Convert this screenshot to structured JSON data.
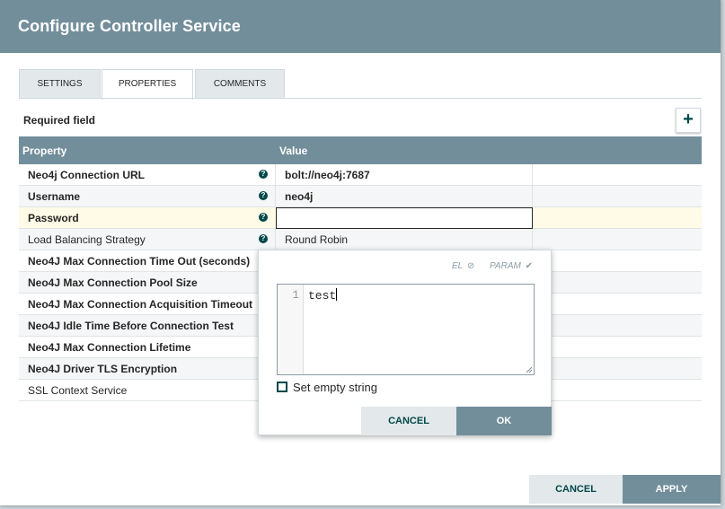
{
  "dialog": {
    "title": "Configure Controller Service"
  },
  "tabs": [
    {
      "label": "SETTINGS",
      "active": false
    },
    {
      "label": "PROPERTIES",
      "active": true
    },
    {
      "label": "COMMENTS",
      "active": false
    }
  ],
  "required_field_label": "Required field",
  "add_property_icon": "plus-icon",
  "table": {
    "headers": {
      "property": "Property",
      "value": "Value"
    },
    "rows": [
      {
        "name": "Neo4j Connection URL",
        "required": true,
        "help": true,
        "value": "bolt://neo4j:7687"
      },
      {
        "name": "Username",
        "required": true,
        "help": true,
        "value": "neo4j"
      },
      {
        "name": "Password",
        "required": true,
        "help": true,
        "value": ""
      },
      {
        "name": "Load Balancing Strategy",
        "required": false,
        "help": true,
        "value": "Round Robin"
      },
      {
        "name": "Neo4J Max Connection Time Out (seconds)",
        "required": true,
        "help": false,
        "value": ""
      },
      {
        "name": "Neo4J Max Connection Pool Size",
        "required": true,
        "help": false,
        "value": ""
      },
      {
        "name": "Neo4J Max Connection Acquisition Timeout",
        "required": true,
        "help": false,
        "value": ""
      },
      {
        "name": "Neo4J Idle Time Before Connection Test",
        "required": true,
        "help": false,
        "value": ""
      },
      {
        "name": "Neo4J Max Connection Lifetime",
        "required": true,
        "help": false,
        "value": ""
      },
      {
        "name": "Neo4J Driver TLS Encryption",
        "required": true,
        "help": false,
        "value": ""
      },
      {
        "name": "SSL Context Service",
        "required": false,
        "help": false,
        "value": ""
      }
    ]
  },
  "editor_popup": {
    "flag_el": "EL",
    "flag_param": "PARAM",
    "line_number": "1",
    "text": "test",
    "set_empty_label": "Set empty string",
    "cancel_label": "CANCEL",
    "ok_label": "OK"
  },
  "footer": {
    "cancel_label": "CANCEL",
    "apply_label": "APPLY"
  },
  "colors": {
    "header": "#728e9b",
    "accent": "#004849",
    "secondary_button": "#e3e8eb"
  }
}
